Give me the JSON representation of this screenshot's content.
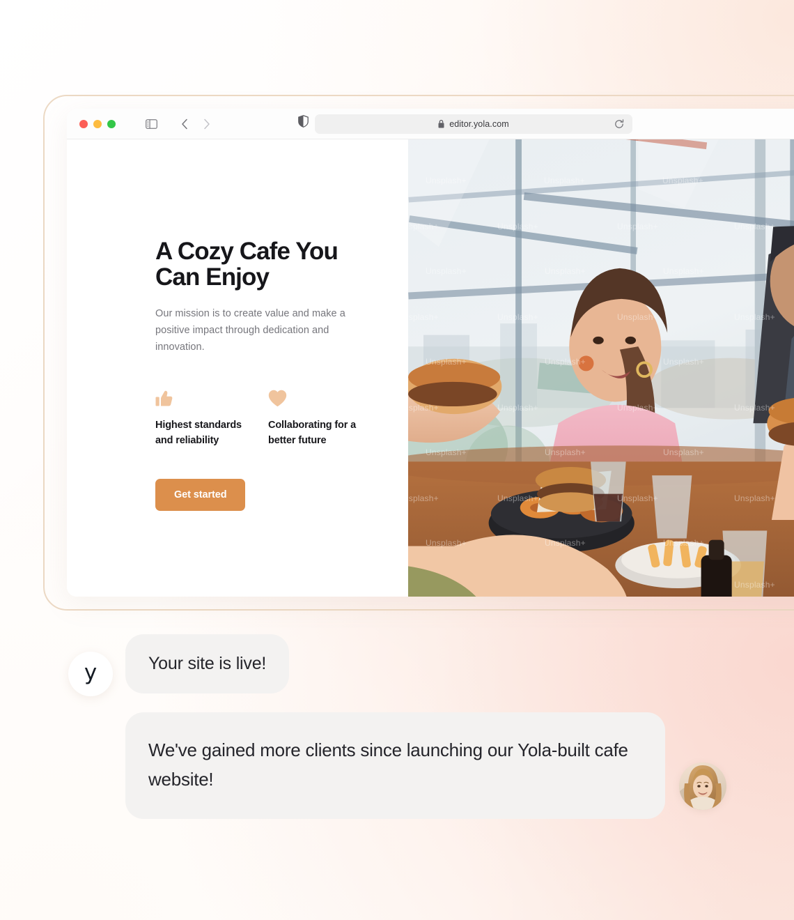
{
  "browser": {
    "traffic_lights": [
      "close",
      "minimize",
      "maximize"
    ],
    "sidebar_toggle_label": "Show sidebar",
    "back_label": "Back",
    "forward_label": "Forward",
    "shield_label": "Privacy report",
    "url": "editor.yola.com",
    "lock_label": "Secure connection",
    "reload_label": "Reload"
  },
  "site": {
    "hero": {
      "title": "A Cozy Cafe You Can Enjoy",
      "subtitle": "Our mission is to create value and make a positive impact through dedication and innovation.",
      "features": [
        {
          "icon": "thumbs-up-icon",
          "label": "Highest standards and reliability"
        },
        {
          "icon": "heart-icon",
          "label": "Collaborating for a better future"
        }
      ],
      "cta_label": "Get started",
      "photo_alt": "Friends eating burgers and fries at a cafe table by a window",
      "photo_watermark": "Unsplash+"
    }
  },
  "chat": {
    "brand_logo_letter": "y",
    "status_message": "Your site is live!",
    "testimonial_message": "We've gained more clients since launching our Yola-built cafe website!",
    "customer_avatar_alt": "Smiling woman portrait"
  },
  "colors": {
    "accent_orange": "#dc8f4c",
    "icon_peach": "#f0c49d",
    "bubble_gray": "#f3f2f1",
    "frame_border": "#ecd9c4",
    "text_dark": "#16161a",
    "text_muted": "#76767c"
  }
}
